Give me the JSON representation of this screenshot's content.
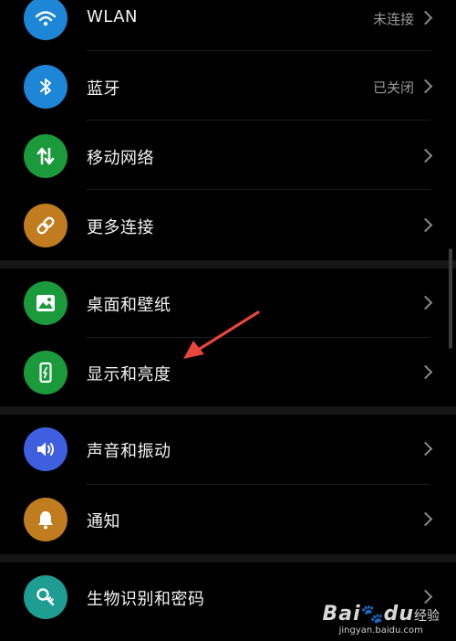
{
  "settings": {
    "items": [
      {
        "label": "WLAN",
        "status": "未连接",
        "icon": "wifi-icon",
        "color": "#1e86d6"
      },
      {
        "label": "蓝牙",
        "status": "已关闭",
        "icon": "bluetooth-icon",
        "color": "#1e86d6"
      },
      {
        "label": "移动网络",
        "status": "",
        "icon": "mobile-data-icon",
        "color": "#1b9a3c"
      },
      {
        "label": "更多连接",
        "status": "",
        "icon": "link-icon",
        "color": "#c07c1e"
      },
      {
        "label": "桌面和壁纸",
        "status": "",
        "icon": "image-icon",
        "color": "#1b9a3c"
      },
      {
        "label": "显示和亮度",
        "status": "",
        "icon": "display-icon",
        "color": "#1b9a3c"
      },
      {
        "label": "声音和振动",
        "status": "",
        "icon": "speaker-icon",
        "color": "#3f5fe0"
      },
      {
        "label": "通知",
        "status": "",
        "icon": "bell-icon",
        "color": "#c07c1e"
      },
      {
        "label": "生物识别和密码",
        "status": "",
        "icon": "key-icon",
        "color": "#1e9e92"
      }
    ]
  },
  "watermark": {
    "brand": "Bai",
    "brand2": "du",
    "suffix": "经验",
    "url": "jingyan.baidu.com"
  },
  "annotation": {
    "arrow_color": "#e8463a"
  }
}
